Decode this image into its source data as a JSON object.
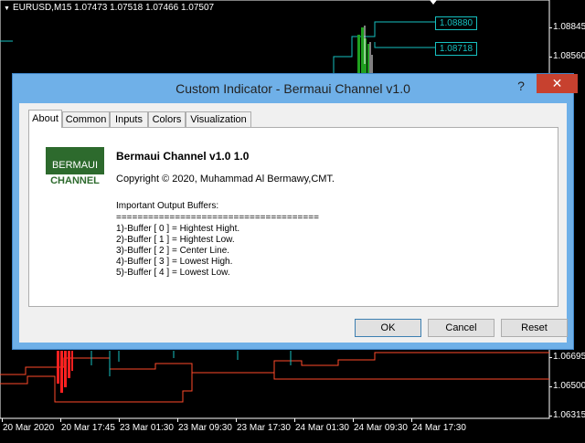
{
  "chart": {
    "symbol_line": "EURUSD,M15  1.07473 1.07518 1.07466 1.07507",
    "price_tags": [
      "1.08880",
      "1.08718"
    ],
    "y_axis": [
      "1.08845",
      "1.08560",
      "1.06695",
      "1.06500",
      "1.06315"
    ],
    "x_axis": [
      "20 Mar 2020",
      "20 Mar 17:45",
      "23 Mar 01:30",
      "23 Mar 09:30",
      "23 Mar 17:30",
      "24 Mar 01:30",
      "24 Mar 09:30",
      "24 Mar 17:30"
    ],
    "colors": {
      "background": "#000000",
      "channel_line": "#16c0c0",
      "lowest_line": "#ff4a2a",
      "bull_bar": "#1f9f1f",
      "bear_bar": "#ff2020"
    }
  },
  "dialog": {
    "title": "Custom Indicator - Bermaui Channel v1.0",
    "help_label": "?",
    "close_label": "✕",
    "tabs": [
      {
        "label": "About",
        "active": true
      },
      {
        "label": "Common",
        "active": false
      },
      {
        "label": "Inputs",
        "active": false
      },
      {
        "label": "Colors",
        "active": false
      },
      {
        "label": "Visualization",
        "active": false
      }
    ],
    "about": {
      "logo_top": "BERMAUI",
      "logo_bottom": "CHANNEL",
      "name": "Bermaui Channel v1.0 1.0",
      "copyright": "Copyright © 2020, Muhammad Al Bermawy,CMT.",
      "lines": [
        "Important Output Buffers:",
        "======================================",
        "1)-Buffer [ 0 ] = Hightest Hight.",
        "2)-Buffer [ 1 ] = Hightest Low.",
        "3)-Buffer [ 2 ] = Center Line.",
        "4)-Buffer [ 3 ] = Lowest High.",
        "5)-Buffer [ 4 ] = Lowest Low."
      ]
    },
    "buttons": {
      "ok": "OK",
      "cancel": "Cancel",
      "reset": "Reset"
    }
  }
}
